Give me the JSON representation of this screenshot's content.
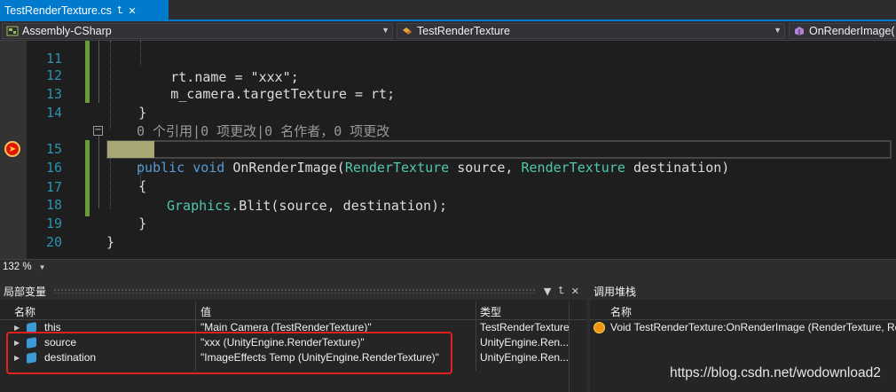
{
  "tab": {
    "title": "TestRenderTexture.cs",
    "pin_icon": "pin-icon",
    "close_icon": "close-icon"
  },
  "navbar": {
    "project": "Assembly-CSharp",
    "class": "TestRenderTexture",
    "member": "OnRenderImage("
  },
  "editor": {
    "lines": [
      {
        "num": "11",
        "code": "        rt.name = \"xxx\";"
      },
      {
        "num": "12",
        "code": "        m_camera.targetTexture = rt;"
      },
      {
        "num": "13",
        "code": "    }"
      },
      {
        "num": "14",
        "code": ""
      },
      {
        "lens": "0 个引用|0 项更改|0 名作者，0 项更改"
      },
      {
        "num": "15",
        "kw": "public void",
        "name": "OnRenderImage",
        "t1": "RenderTexture",
        "p1": "source,",
        "t2": "RenderTexture",
        "p2": "destination)"
      },
      {
        "num": "16",
        "code": "    {"
      },
      {
        "num": "17",
        "cls": "Graphics",
        "code": ".Blit(source, destination);"
      },
      {
        "num": "18",
        "code": "    }"
      },
      {
        "num": "19",
        "code": "}"
      },
      {
        "num": "20",
        "code": ""
      }
    ]
  },
  "zoom": {
    "value": "132 %"
  },
  "locals": {
    "title": "局部变量",
    "columns": {
      "name": "名称",
      "value": "值",
      "type": "类型"
    },
    "rows": [
      {
        "name": "this",
        "value": "\"Main Camera (TestRenderTexture)\"",
        "type": "TestRenderTexture"
      },
      {
        "name": "source",
        "value": "\"xxx (UnityEngine.RenderTexture)\"",
        "type": "UnityEngine.Ren..."
      },
      {
        "name": "destination",
        "value": "\"ImageEffects Temp (UnityEngine.RenderTexture)\"",
        "type": "UnityEngine.Ren..."
      }
    ]
  },
  "callstack": {
    "title": "调用堆栈",
    "columns": {
      "name": "名称"
    },
    "rows": [
      {
        "name": "Void TestRenderTexture:OnRenderImage (RenderTexture, Renc"
      }
    ]
  },
  "watermark": "https://blog.csdn.net/wodownload2",
  "colors": {
    "accent": "#007acc",
    "keyword": "#569cd6",
    "type": "#4ec9b0",
    "linenum": "#2b91af",
    "highlight": "#e22020"
  }
}
